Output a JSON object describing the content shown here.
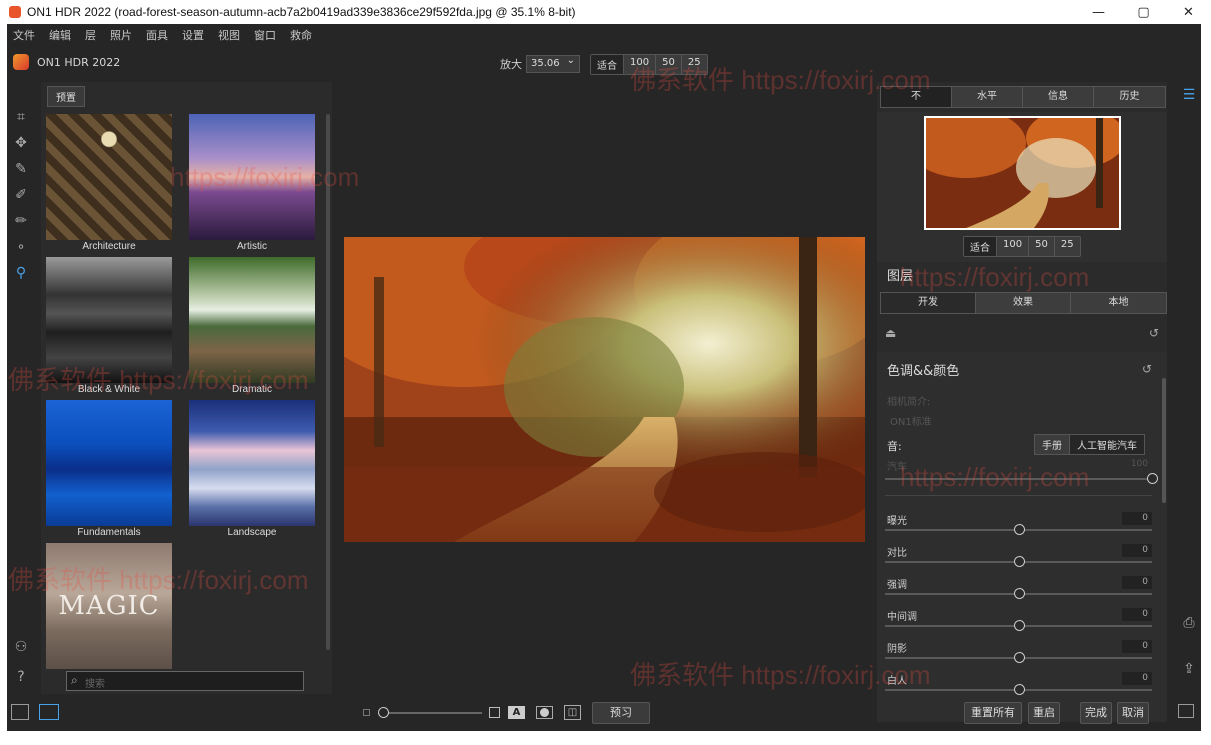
{
  "window": {
    "title": "ON1 HDR 2022 (road-forest-season-autumn-acb7a2b0419ad339e3836ce29f592fda.jpg @ 35.1% 8-bit)",
    "minimize": "—",
    "maximize": "▢",
    "close": "✕"
  },
  "menu": [
    "文件",
    "编辑",
    "层",
    "照片",
    "面具",
    "设置",
    "视图",
    "窗口",
    "救命"
  ],
  "app_name": "ON1 HDR 2022",
  "zoom": {
    "label": "放大",
    "value": "35.06",
    "presets": [
      "适合",
      "100",
      "50",
      "25"
    ]
  },
  "left_tools": [
    "crop-icon",
    "move-icon",
    "brush-icon",
    "mask-brush-icon",
    "refine-brush-icon",
    "retouch-icon",
    "zoom-hand-icon"
  ],
  "presets": {
    "button": "预置",
    "items": [
      {
        "label": "Architecture"
      },
      {
        "label": "Artistic"
      },
      {
        "label": "Black & White"
      },
      {
        "label": "Dramatic"
      },
      {
        "label": "Fundamentals"
      },
      {
        "label": "Landscape"
      },
      {
        "label": "",
        "overlay": "MAGIC"
      }
    ],
    "search_placeholder": "搜索"
  },
  "right_panel": {
    "view_tabs": [
      "不",
      "水平",
      "信息",
      "历史"
    ],
    "nav_zoom": [
      "适合",
      "100",
      "50",
      "25"
    ],
    "layers_title": "图层",
    "develop_tabs": [
      "开发",
      "效果",
      "本地"
    ],
    "section_title": "色调&&颜色",
    "camera_profile_label": "相机简介:",
    "camera_profile_value": "ON1标准",
    "sound_label": "音:",
    "mode_tabs": [
      "手册",
      "人工智能汽车"
    ],
    "auto_label": "汽车",
    "auto_value": "100",
    "sliders": [
      {
        "label": "曝光",
        "value": "0",
        "pos": 0.5
      },
      {
        "label": "对比",
        "value": "0",
        "pos": 0.5
      },
      {
        "label": "强调",
        "value": "0",
        "pos": 0.5
      },
      {
        "label": "中间调",
        "value": "0",
        "pos": 0.5
      },
      {
        "label": "阴影",
        "value": "0",
        "pos": 0.5
      },
      {
        "label": "白人",
        "value": "0",
        "pos": 0.5
      }
    ]
  },
  "bottom": {
    "preview": "预习",
    "reset_all": "重置所有",
    "reset": "重启",
    "done": "完成",
    "cancel": "取消"
  },
  "watermarks": [
    "佛系软件 https://foxirj.com",
    "https://foxirj.com"
  ],
  "colors": {
    "accent": "#4aa3e8",
    "bg": "#262626"
  }
}
